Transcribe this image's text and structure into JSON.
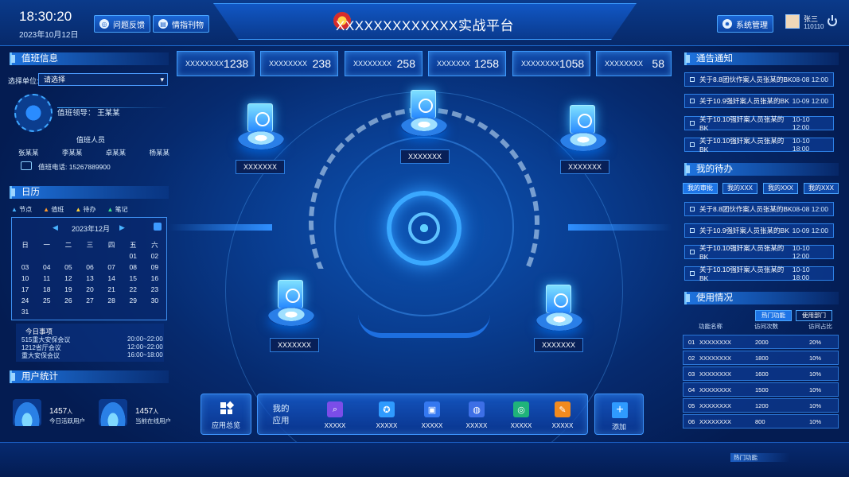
{
  "header": {
    "time": "18:30:20",
    "date": "2023年10月12日",
    "feedback_btn": "问题反馈",
    "intel_btn": "情指刊物",
    "title": "XXXXXXXXXXXXX实战平台",
    "sys_btn": "系统管理",
    "user_name": "张三",
    "user_id": "110110"
  },
  "stats": [
    {
      "label": "XXXXXXXX",
      "value": "1238"
    },
    {
      "label": "XXXXXXXX",
      "value": "238"
    },
    {
      "label": "XXXXXXXX",
      "value": "258"
    },
    {
      "label": "XXXXXXX",
      "value": "1258"
    },
    {
      "label": "XXXXXXXX",
      "value": "1058"
    },
    {
      "label": "XXXXXXXX",
      "value": "58"
    }
  ],
  "duty": {
    "title": "值班信息",
    "select_label": "选择单位:",
    "select_value": "请选择",
    "leader": "值班领导： 王某某",
    "staff_label": "值班人员",
    "staff": [
      "张某某",
      "李某某",
      "卓某某",
      "杨某某"
    ],
    "phone": "值班电话: 15267889900"
  },
  "calendar": {
    "title": "日历",
    "legend": [
      "节点",
      "值班",
      "待办",
      "笔记"
    ],
    "month": "2023年12月",
    "weekdays": [
      "日",
      "一",
      "二",
      "三",
      "四",
      "五",
      "六"
    ],
    "days": [
      "",
      "",
      "",
      "",
      "",
      "01",
      "02",
      "03",
      "04",
      "05",
      "06",
      "07",
      "08",
      "09",
      "10",
      "11",
      "12",
      "13",
      "14",
      "15",
      "16",
      "17",
      "18",
      "19",
      "20",
      "21",
      "22",
      "23",
      "24",
      "25",
      "26",
      "27",
      "28",
      "29",
      "30",
      "31",
      "",
      "",
      "",
      "",
      "",
      ""
    ],
    "today_title": "今日事项",
    "events": [
      {
        "name": "515重大安保会议",
        "time": "20:00~22:00"
      },
      {
        "name": "1212省厅会议",
        "time": "12:00~22:00"
      },
      {
        "name": "重大安保会议",
        "time": "16:00~18:00"
      }
    ]
  },
  "user_stats": {
    "title": "用户统计",
    "active_value": "1457",
    "active_unit": "人",
    "active_label": "今日活跃用户",
    "online_value": "1457",
    "online_unit": "人",
    "online_label": "当前在线用户"
  },
  "center": {
    "labels": [
      "XXXXXXX",
      "XXXXXXX",
      "XXXXXXX",
      "XXXXXXX",
      "XXXXXXX"
    ]
  },
  "notice": {
    "title": "通告通知",
    "items": [
      {
        "text": "关于8.8团伙作案人员张某的BK",
        "date": "08-08 12:00"
      },
      {
        "text": "关于10.9强奸案人员张某的BK",
        "date": "10-09 12:00"
      },
      {
        "text": "关于10.10强奸案人员张某的BK",
        "date": "10-10 12:00"
      },
      {
        "text": "关于10.10强奸案人员张某的BK",
        "date": "10-10 18:00"
      }
    ]
  },
  "todo": {
    "title": "我的待办",
    "tabs": [
      "我的审批",
      "我的XXX",
      "我的XXX",
      "我的XXX"
    ],
    "items": [
      {
        "text": "关于8.8团伙作案人员张某的BK",
        "date": "08-08 12:00"
      },
      {
        "text": "关于10.9强奸案人员张某的BK",
        "date": "10-09 12:00"
      },
      {
        "text": "关于10.10强奸案人员张某的BK",
        "date": "10-10 12:00"
      },
      {
        "text": "关于10.10强奸案人员张某的BK",
        "date": "10-10 18:00"
      }
    ]
  },
  "usage": {
    "title": "使用情况",
    "tabs": [
      "热门功能",
      "使用部门"
    ],
    "columns": [
      "功能名称",
      "访问次数",
      "访问占比"
    ],
    "rows": [
      {
        "no": "01",
        "name": "XXXXXXXX",
        "count": "2000",
        "pct": "20%"
      },
      {
        "no": "02",
        "name": "XXXXXXXX",
        "count": "1800",
        "pct": "10%"
      },
      {
        "no": "03",
        "name": "XXXXXXXX",
        "count": "1600",
        "pct": "10%"
      },
      {
        "no": "04",
        "name": "XXXXXXXX",
        "count": "1500",
        "pct": "10%"
      },
      {
        "no": "05",
        "name": "XXXXXXXX",
        "count": "1200",
        "pct": "10%"
      },
      {
        "no": "06",
        "name": "XXXXXXXX",
        "count": "800",
        "pct": "10%"
      }
    ],
    "bottom_tab": "热门功能"
  },
  "bottom": {
    "overview": "应用总览",
    "my_apps": "我的应用",
    "apps": [
      "XXXXX",
      "XXXXX",
      "XXXXX",
      "XXXXX",
      "XXXXX",
      "XXXXX"
    ],
    "add": "添加"
  },
  "colors": {
    "accent": "#3d9bff",
    "bg": "#093e92",
    "text": "#dff0ff"
  }
}
